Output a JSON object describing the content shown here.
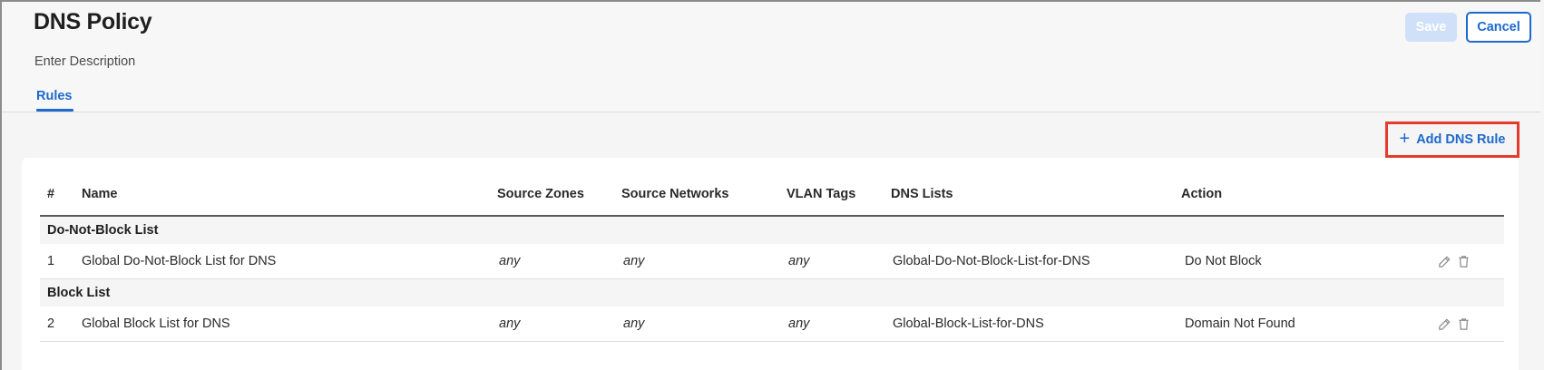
{
  "header": {
    "title": "DNS Policy",
    "description_placeholder": "Enter Description",
    "tabs": [
      {
        "label": "Rules",
        "active": true
      }
    ],
    "save_label": "Save",
    "cancel_label": "Cancel"
  },
  "toolbar": {
    "add_rule_label": "Add DNS Rule",
    "add_rule_icon": "plus-icon",
    "highlight_color": "#e53b2c"
  },
  "table": {
    "columns": [
      "#",
      "Name",
      "Source Zones",
      "Source Networks",
      "VLAN Tags",
      "DNS Lists",
      "Action"
    ],
    "groups": [
      {
        "label": "Do-Not-Block List",
        "rows": [
          {
            "num": "1",
            "name": "Global Do-Not-Block List for DNS",
            "source_zones": "any",
            "source_networks": "any",
            "vlan_tags": "any",
            "dns_lists": "Global-Do-Not-Block-List-for-DNS",
            "action": "Do Not Block"
          }
        ]
      },
      {
        "label": "Block List",
        "rows": [
          {
            "num": "2",
            "name": "Global Block List for DNS",
            "source_zones": "any",
            "source_networks": "any",
            "vlan_tags": "any",
            "dns_lists": "Global-Block-List-for-DNS",
            "action": "Domain Not Found"
          }
        ]
      }
    ],
    "row_icons": [
      "edit-icon",
      "trash-icon"
    ]
  },
  "colors": {
    "accent": "#1d69cc",
    "save_disabled": "#cfe0f8"
  }
}
